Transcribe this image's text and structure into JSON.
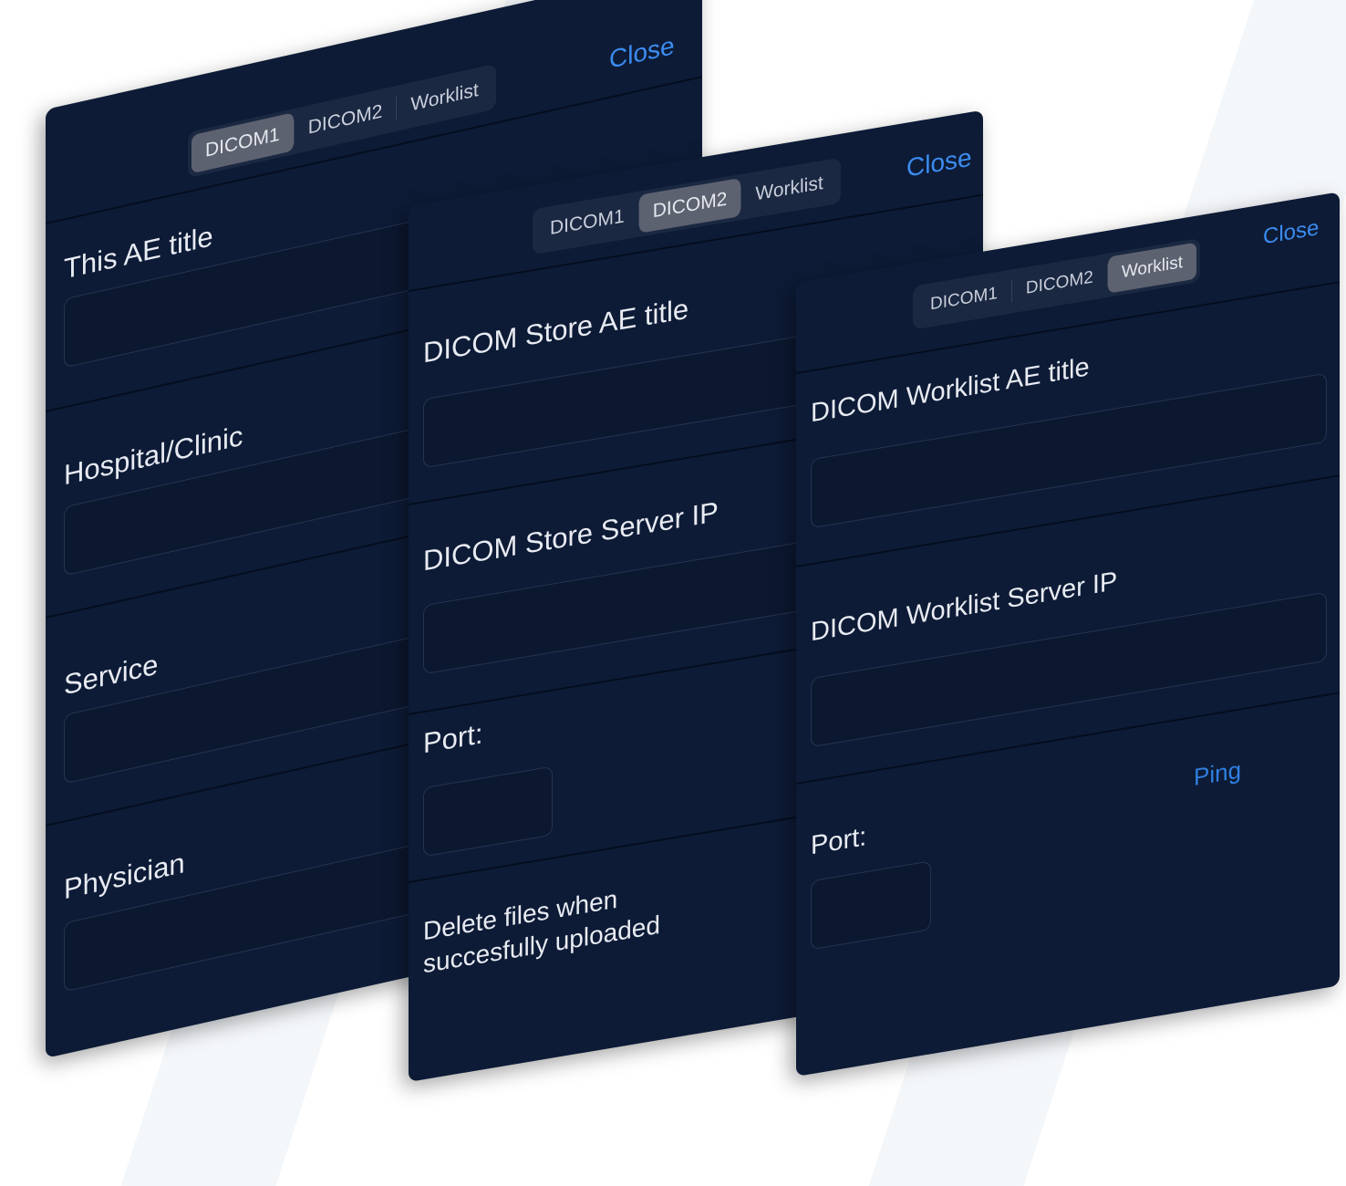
{
  "panels": [
    {
      "id": "dicom1",
      "tabs": [
        "DICOM1",
        "DICOM2",
        "Worklist"
      ],
      "active_tab": "DICOM1",
      "close_label": "Close",
      "fields": [
        {
          "label": "This AE title",
          "value": ""
        },
        {
          "label": "Hospital/Clinic",
          "value": ""
        },
        {
          "label": "Service",
          "value": ""
        },
        {
          "label": "Physician",
          "value": ""
        }
      ]
    },
    {
      "id": "dicom2",
      "tabs": [
        "DICOM1",
        "DICOM2",
        "Worklist"
      ],
      "active_tab": "DICOM2",
      "close_label": "Close",
      "fields": [
        {
          "label": "DICOM Store AE title",
          "value": ""
        },
        {
          "label": "DICOM Store Server IP",
          "value": ""
        },
        {
          "label": "Port:",
          "value": ""
        }
      ],
      "delete_files_label": "Delete files when succesfully uploaded"
    },
    {
      "id": "worklist",
      "tabs": [
        "DICOM1",
        "DICOM2",
        "Worklist"
      ],
      "active_tab": "Worklist",
      "close_label": "Close",
      "fields": [
        {
          "label": "DICOM Worklist AE title",
          "value": ""
        },
        {
          "label": "DICOM Worklist Server IP",
          "value": ""
        },
        {
          "label": "Port:",
          "value": ""
        }
      ],
      "ping_label": "Ping"
    }
  ],
  "colors": {
    "panel_bg": "#0d1b36",
    "accent": "#3c8cf0",
    "active_tab_bg": "#5d6270"
  }
}
